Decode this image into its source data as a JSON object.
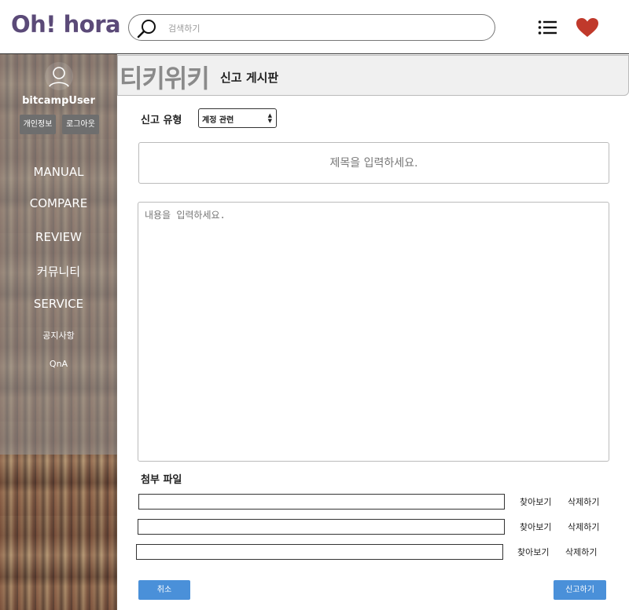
{
  "header": {
    "logo": "Oh! hora",
    "search_placeholder": "검색하기",
    "heart_color": "#c0392b"
  },
  "sidebar": {
    "username": "bitcampUser",
    "profile_button": "개인정보",
    "logout_button": "로그아웃",
    "nav": [
      "MANUAL",
      "COMPARE",
      "REVIEW",
      "커뮤니티",
      "SERVICE"
    ],
    "sub_nav": [
      "공지사항",
      "QnA"
    ]
  },
  "page": {
    "title": "티키위키",
    "subtitle": "신고 게시판"
  },
  "form": {
    "report_type_label": "신고 유형",
    "report_type_value": "계정 관련",
    "title_placeholder": "제목을 입력하세요.",
    "content_placeholder": "내용을 입력하세요.",
    "attachment_label": "첨부 파일",
    "browse_label": "찾아보기",
    "delete_label": "삭제하기",
    "cancel_button": "취소",
    "submit_button": "신고하기"
  },
  "colors": {
    "logo": "#5b4a78",
    "button": "#4a90d9"
  }
}
